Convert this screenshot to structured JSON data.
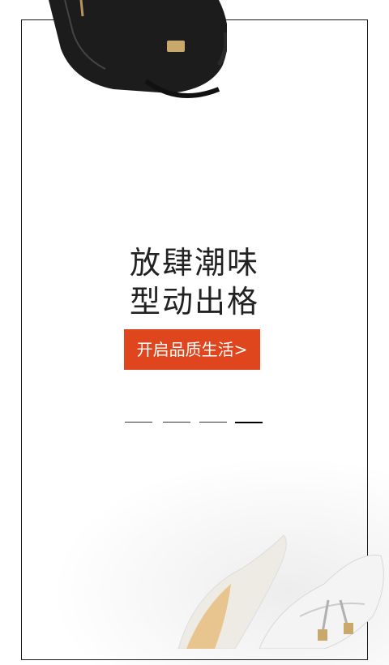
{
  "hero": {
    "headline_line1": "放肆潮味",
    "headline_line2": "型动出格"
  },
  "cta": {
    "label": "开启品质生活>"
  },
  "pager": {
    "count": 4,
    "active_index": 3
  },
  "colors": {
    "accent": "#e0461e",
    "frame": "#1a1a1a",
    "text": "#222222"
  }
}
